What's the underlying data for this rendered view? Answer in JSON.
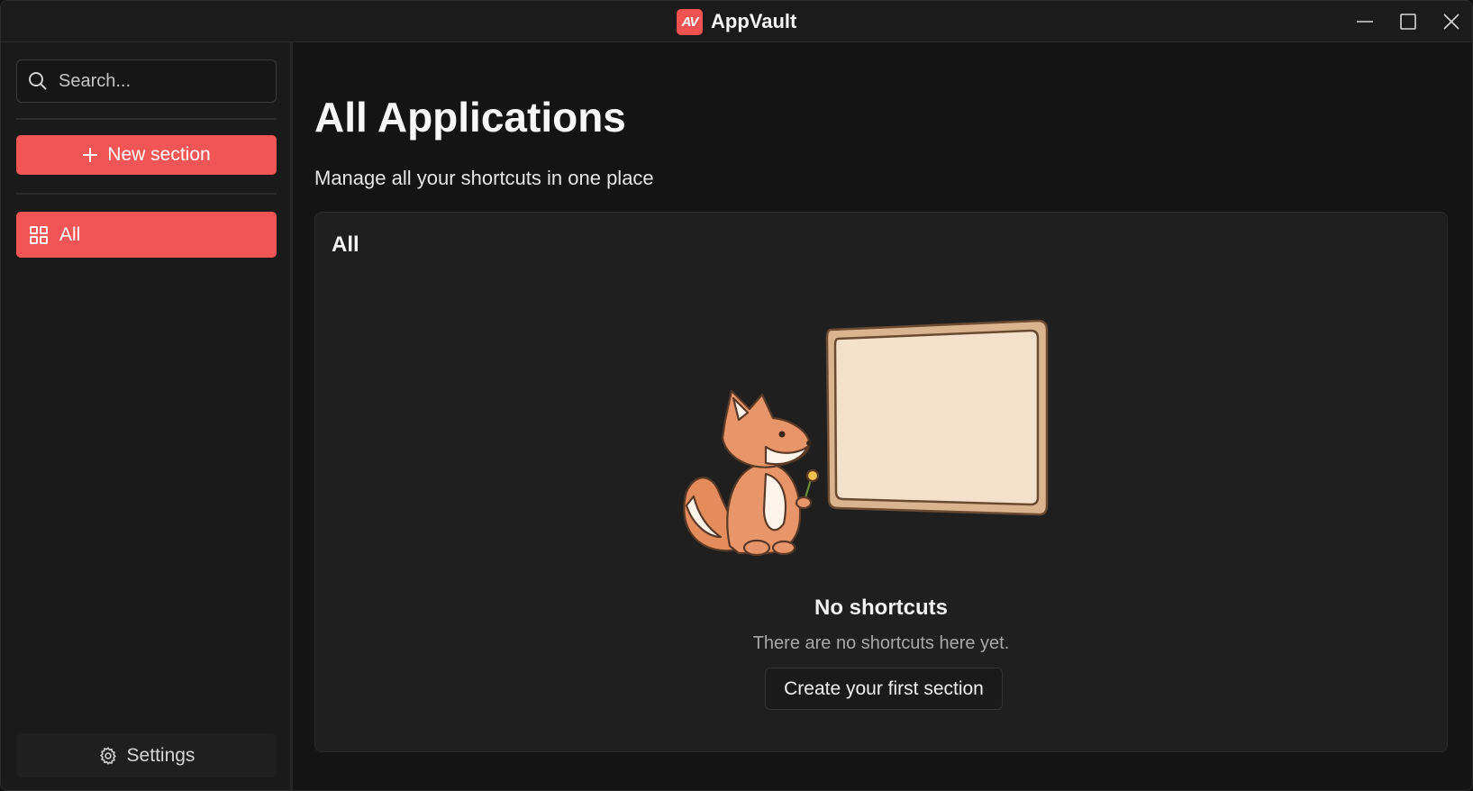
{
  "titlebar": {
    "logo_text": "AV",
    "app_title": "AppVault",
    "minimize_icon": "minimize-icon",
    "maximize_icon": "maximize-icon",
    "close_icon": "close-icon"
  },
  "sidebar": {
    "search_placeholder": "Search...",
    "new_section_label": "New section",
    "nav_items": [
      {
        "label": "All",
        "icon": "grid-icon",
        "active": true
      }
    ],
    "settings_label": "Settings"
  },
  "main": {
    "title": "All Applications",
    "subtitle": "Manage all your shortcuts in one place",
    "panel": {
      "title": "All",
      "empty_state": {
        "illustration": "fox-with-blank-board",
        "title": "No shortcuts",
        "description": "There are no shortcuts here yet.",
        "cta_label": "Create your first section"
      }
    }
  },
  "colors": {
    "accent": "#f25555",
    "background": "#141414",
    "sidebar_bg": "#1a1a1a",
    "panel_bg": "#1f1f1f"
  }
}
